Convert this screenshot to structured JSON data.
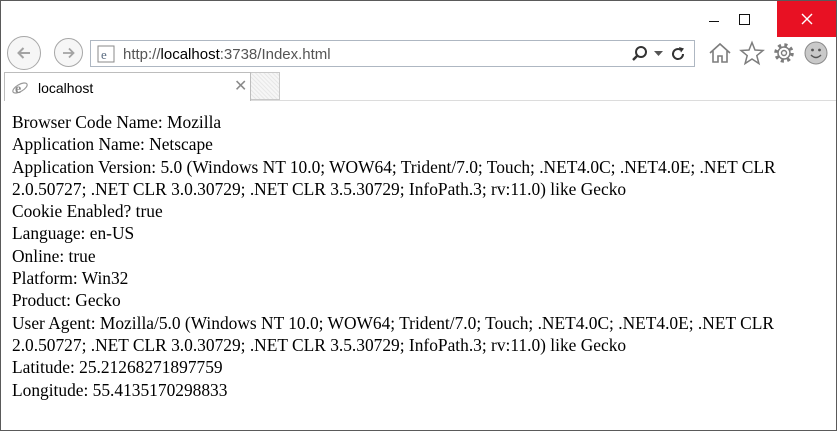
{
  "browser": {
    "address_url_prefix": "http://",
    "address_url_host": "localhost",
    "address_url_rest": ":3738/Index.html",
    "tab_title": "localhost",
    "close_color": "#e81123"
  },
  "content": {
    "lines": [
      "Browser Code Name: Mozilla",
      "Application Name: Netscape",
      "Application Version: 5.0 (Windows NT 10.0; WOW64; Trident/7.0; Touch; .NET4.0C; .NET4.0E; .NET CLR 2.0.50727; .NET CLR 3.0.30729; .NET CLR 3.5.30729; InfoPath.3; rv:11.0) like Gecko",
      "Cookie Enabled? true",
      "Language: en-US",
      "Online: true",
      "Platform: Win32",
      "Product: Gecko",
      "User Agent: Mozilla/5.0 (Windows NT 10.0; WOW64; Trident/7.0; Touch; .NET4.0C; .NET4.0E; .NET CLR 2.0.50727; .NET CLR 3.0.30729; .NET CLR 3.5.30729; InfoPath.3; rv:11.0) like Gecko",
      "Latitude: 25.21268271897759",
      "Longitude: 55.4135170298833"
    ]
  }
}
